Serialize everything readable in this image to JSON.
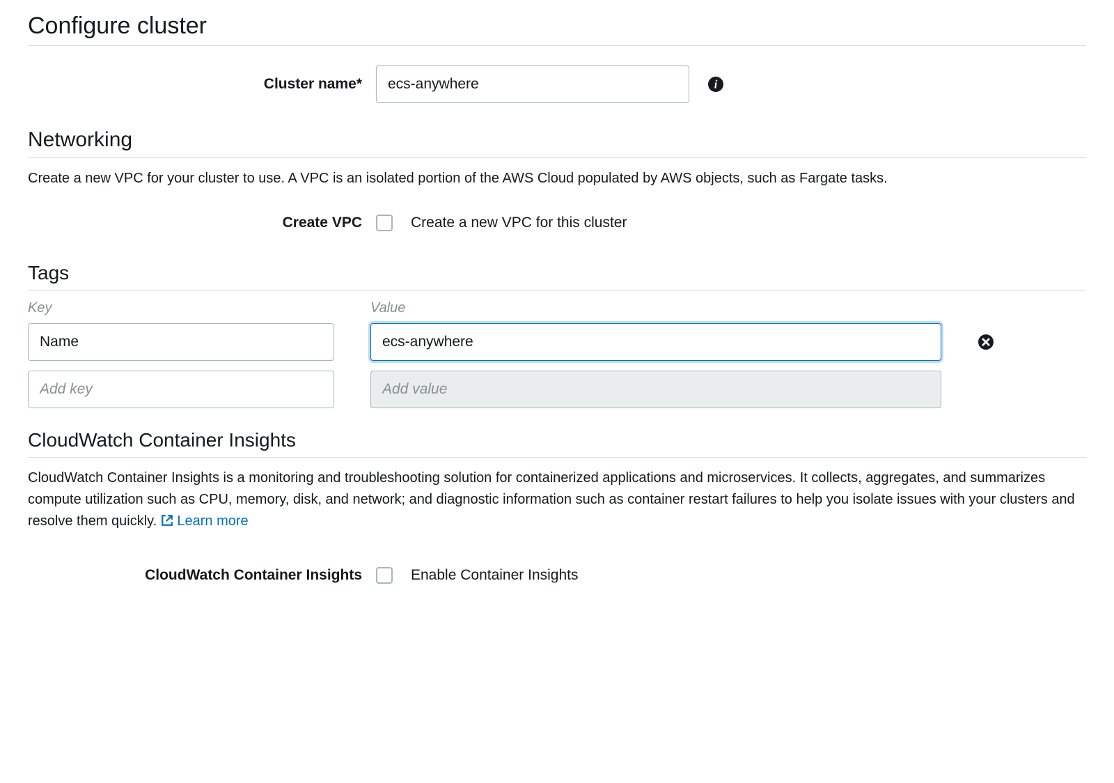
{
  "configure": {
    "heading": "Configure cluster",
    "cluster_name_label": "Cluster name*",
    "cluster_name_value": "ecs-anywhere"
  },
  "networking": {
    "heading": "Networking",
    "description": "Create a new VPC for your cluster to use. A VPC is an isolated portion of the AWS Cloud populated by AWS objects, such as Fargate tasks.",
    "create_vpc_label": "Create VPC",
    "create_vpc_checkbox_label": "Create a new VPC for this cluster"
  },
  "tags": {
    "heading": "Tags",
    "key_header": "Key",
    "value_header": "Value",
    "rows": [
      {
        "key": "Name",
        "value": "ecs-anywhere"
      }
    ],
    "add_key_placeholder": "Add key",
    "add_value_placeholder": "Add value"
  },
  "insights": {
    "heading": "CloudWatch Container Insights",
    "description_prefix": "CloudWatch Container Insights is a monitoring and troubleshooting solution for containerized applications and microservices. It collects, aggregates, and summarizes compute utilization such as CPU, memory, disk, and network; and diagnostic information such as container restart failures to help you isolate issues with your clusters and resolve them quickly. ",
    "learn_more": "Learn more",
    "label": "CloudWatch Container Insights",
    "checkbox_label": "Enable Container Insights"
  }
}
